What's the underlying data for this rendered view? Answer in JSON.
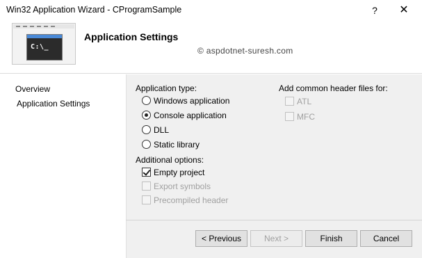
{
  "window": {
    "title": "Win32 Application Wizard - CProgramSample",
    "help_glyph": "?",
    "close_glyph": "✕"
  },
  "header": {
    "title": "Application Settings",
    "watermark": "© aspdotnet-suresh.com",
    "thumbnail_prompt": "C:\\_"
  },
  "nav": {
    "items": [
      {
        "label": "Overview",
        "selected": false
      },
      {
        "label": "Application Settings",
        "selected": true
      }
    ]
  },
  "application_type": {
    "label": "Application type:",
    "options": [
      {
        "label": "Windows application",
        "selected": false
      },
      {
        "label": "Console application",
        "selected": true
      },
      {
        "label": "DLL",
        "selected": false
      },
      {
        "label": "Static library",
        "selected": false
      }
    ]
  },
  "additional_options": {
    "label": "Additional options:",
    "options": [
      {
        "label": "Empty project",
        "checked": true,
        "enabled": true
      },
      {
        "label": "Export symbols",
        "checked": false,
        "enabled": false
      },
      {
        "label": "Precompiled header",
        "checked": false,
        "enabled": false
      }
    ]
  },
  "common_headers": {
    "label": "Add common header files for:",
    "options": [
      {
        "label": "ATL",
        "checked": false,
        "enabled": false
      },
      {
        "label": "MFC",
        "checked": false,
        "enabled": false
      }
    ]
  },
  "buttons": {
    "previous": "< Previous",
    "next": "Next >",
    "finish": "Finish",
    "cancel": "Cancel"
  },
  "colors": {
    "main_pane_bg": "#f0f0f0",
    "button_bg": "#e1e1e1",
    "disabled_text": "#a0a0a0"
  }
}
